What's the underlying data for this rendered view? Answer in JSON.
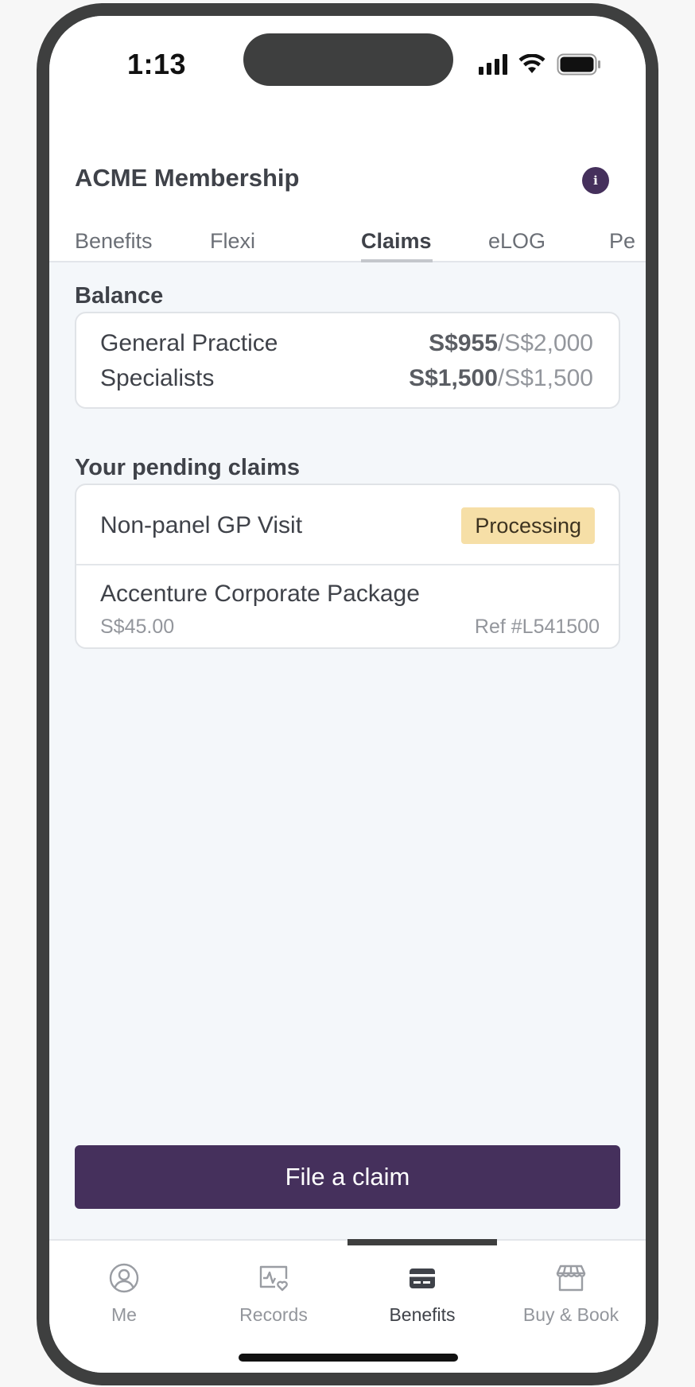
{
  "status": {
    "time": "1:13"
  },
  "header": {
    "title": "ACME Membership",
    "info_icon": "i",
    "tabs": [
      {
        "label": "Benefits"
      },
      {
        "label": "Flexi"
      },
      {
        "label": "Claims"
      },
      {
        "label": "eLOG"
      },
      {
        "label": "Pe"
      }
    ],
    "active_tab": "Claims"
  },
  "balance": {
    "title": "Balance",
    "rows": [
      {
        "label": "General Practice",
        "used": "S$955",
        "total": "/S$2,000"
      },
      {
        "label": "Specialists",
        "used": "S$1,500",
        "total": "/S$1,500"
      }
    ]
  },
  "pending": {
    "title": "Your pending claims",
    "claims": [
      {
        "name": "Non-panel GP Visit",
        "status": "Processing",
        "package": "Accenture Corporate Package",
        "amount": "S$45.00",
        "ref": "Ref #L541500"
      }
    ]
  },
  "actions": {
    "file_claim": "File a claim"
  },
  "bottom_nav": {
    "items": [
      {
        "label": "Me",
        "icon": "user-circle-icon"
      },
      {
        "label": "Records",
        "icon": "health-record-icon"
      },
      {
        "label": "Benefits",
        "icon": "card-icon"
      },
      {
        "label": "Buy & Book",
        "icon": "store-icon"
      }
    ],
    "active": "Benefits"
  },
  "colors": {
    "brand": "#45305c",
    "badge_processing": "#f6dfa7",
    "background": "#f4f7fa"
  }
}
